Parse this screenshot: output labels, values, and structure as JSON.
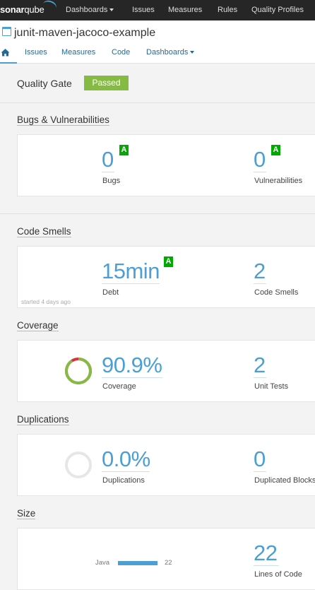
{
  "topnav": {
    "logo_main": "sonar",
    "logo_sub": "qube",
    "items": [
      "Dashboards",
      "Issues",
      "Measures",
      "Rules",
      "Quality Profiles"
    ]
  },
  "project": {
    "title": "junit-maven-jacoco-example",
    "tabs": [
      "Issues",
      "Measures",
      "Code",
      "Dashboards"
    ]
  },
  "quality_gate": {
    "label": "Quality Gate",
    "status": "Passed",
    "status_color": "#85bb43"
  },
  "bugs_vulns": {
    "title": "Bugs & Vulnerabilities",
    "bugs": {
      "value": "0",
      "label": "Bugs",
      "rating": "A"
    },
    "vulns": {
      "value": "0",
      "label": "Vulnerabilities",
      "rating": "A"
    }
  },
  "code_smells": {
    "title": "Code Smells",
    "debt": {
      "value": "15min",
      "label": "Debt",
      "rating": "A"
    },
    "smells": {
      "value": "2",
      "label": "Code Smells"
    },
    "started": "started 4 days ago"
  },
  "coverage": {
    "title": "Coverage",
    "coverage": {
      "value": "90.9%",
      "label": "Coverage",
      "percent": 90.9
    },
    "tests": {
      "value": "2",
      "label": "Unit Tests"
    }
  },
  "duplications": {
    "title": "Duplications",
    "dup": {
      "value": "0.0%",
      "label": "Duplications",
      "percent": 0.0
    },
    "blocks": {
      "value": "0",
      "label": "Duplicated Blocks"
    }
  },
  "size": {
    "title": "Size",
    "lang": {
      "name": "Java",
      "value": "22"
    },
    "loc": {
      "value": "22",
      "label": "Lines of Code"
    }
  },
  "colors": {
    "accent": "#4b9fd5",
    "rating_a": "#00aa00",
    "coverage_ok": "#85bb43",
    "coverage_miss": "#d4333f"
  }
}
